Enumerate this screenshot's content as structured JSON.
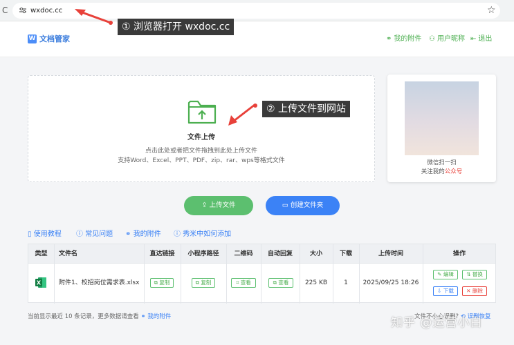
{
  "browser": {
    "url": "wxdoc.cc",
    "reload_glyph": "C",
    "star_glyph": "☆"
  },
  "annotations": {
    "step1": "① 浏览器打开 wxdoc.cc",
    "step2": "② 上传文件到网站",
    "color": "#e8413a"
  },
  "header": {
    "logo_badge": "W",
    "logo_text": "文档管家",
    "nav": [
      {
        "icon": "link-icon",
        "glyph": "⚭",
        "label": "我的附件"
      },
      {
        "icon": "user-icon",
        "glyph": "⚇",
        "label": "用户昵称"
      },
      {
        "icon": "logout-icon",
        "glyph": "⇤",
        "label": "退出"
      }
    ]
  },
  "upload": {
    "title": "文件上传",
    "hint1": "点击此处或者把文件拖拽到此处上传文件",
    "hint2": "支持Word、Excel、PPT、PDF、zip、rar、wps等格式文件"
  },
  "qr": {
    "caption1": "微信扫一扫",
    "caption2_prefix": "关注我的",
    "caption2_highlight": "公众号"
  },
  "actions": {
    "upload_label": "上传文件",
    "upload_glyph": "⇪",
    "folder_label": "创建文件夹",
    "folder_glyph": "▭"
  },
  "help_links": [
    {
      "icon": "book-icon",
      "glyph": "📖",
      "label": "使用教程"
    },
    {
      "icon": "question-icon",
      "glyph": "?",
      "label": "常见问题"
    },
    {
      "icon": "link-icon",
      "glyph": "⚭",
      "label": "我的附件"
    },
    {
      "icon": "info-icon",
      "glyph": "ⓘ",
      "label": "秀米中如何添加"
    }
  ],
  "table": {
    "headers": [
      "类型",
      "文件名",
      "直达链接",
      "小程序路径",
      "二维码",
      "自动回复",
      "大小",
      "下载",
      "上传时间",
      "操作"
    ],
    "rows": [
      {
        "type_icon": "excel-icon",
        "filename": "附件1、校招岗位需求表.xlsx",
        "direct_link_btn": "复制",
        "mini_path_btn": "复制",
        "qrcode_btn": "查看",
        "auto_reply_btn": "查看",
        "size": "225 KB",
        "downloads": "1",
        "upload_time": "2025/09/25 18:26",
        "ops": [
          "编辑",
          "替换",
          "下载",
          "删除"
        ]
      }
    ]
  },
  "footer": {
    "left_text": "当前显示最近 10 条记录，更多数据请查看",
    "left_link": "我的附件",
    "right_text": "文件不小心误删?",
    "right_link": "误删恢复"
  },
  "watermark": "知乎 @运营小白"
}
